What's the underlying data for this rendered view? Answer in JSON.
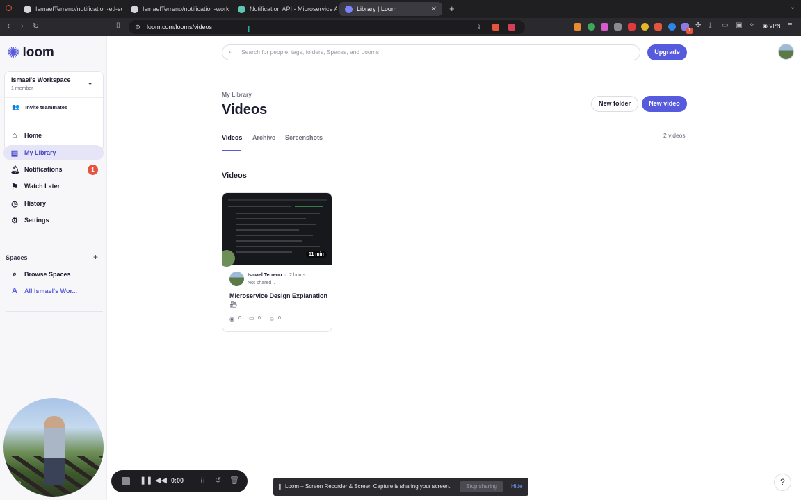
{
  "browser": {
    "tabs": [
      {
        "label": "IsmaelTerreno/notification-etl-se",
        "icon": "github-icon"
      },
      {
        "label": "IsmaelTerreno/notification-worke",
        "icon": "github-icon"
      },
      {
        "label": "Notification API - Microservice A",
        "icon": "document-icon"
      },
      {
        "label": "Library | Loom",
        "icon": "loom-icon"
      }
    ],
    "url": "loom.com/looms/videos",
    "vpn_label": "VPN",
    "extension_badge": "1"
  },
  "sidebar": {
    "logo_text": "loom",
    "workspace_name": "Ismael's Workspace",
    "workspace_members": "1 member",
    "invite_label": "Invite teammates",
    "nav": [
      {
        "label": "Home",
        "icon": "home-icon"
      },
      {
        "label": "My Library",
        "icon": "library-icon"
      },
      {
        "label": "Notifications",
        "icon": "bell-icon"
      },
      {
        "label": "Watch Later",
        "icon": "bookmark-icon"
      },
      {
        "label": "History",
        "icon": "clock-icon"
      },
      {
        "label": "Settings",
        "icon": "gear-icon"
      }
    ],
    "notifications_count": "1",
    "spaces_heading": "Spaces",
    "spaces": [
      {
        "label": "Browse Spaces",
        "icon": "search-icon"
      },
      {
        "label": "All Ismael's Wor...",
        "icon_letter": "A"
      }
    ],
    "camera_zoom": "50%"
  },
  "main": {
    "search_placeholder": "Search for people, tags, folders, Spaces, and Looms",
    "upgrade_label": "Upgrade",
    "breadcrumb": "My Library",
    "title": "Videos",
    "new_folder_label": "New folder",
    "new_video_label": "New video",
    "tabs": [
      "Videos",
      "Archive",
      "Screenshots"
    ],
    "video_count": "2 videos",
    "section_heading": "Videos",
    "video": {
      "duration": "11 min",
      "author": "Ismael Terreno",
      "time_ago": "2 hours",
      "share_status": "Not shared",
      "title": "Microservice Design Explanation",
      "views": "0",
      "comments": "0",
      "reactions": "0"
    }
  },
  "recorder": {
    "timer": "0:00",
    "sharing_message": "Loom – Screen Recorder & Screen Capture is sharing your screen.",
    "stop_sharing_label": "Stop sharing",
    "hide_label": "Hide"
  },
  "help_label": "?",
  "colors": {
    "accent": "#565add",
    "badge": "#e5543c",
    "sidebar_bg": "#f7f7f9",
    "browser_bg": "#1f1f22"
  }
}
